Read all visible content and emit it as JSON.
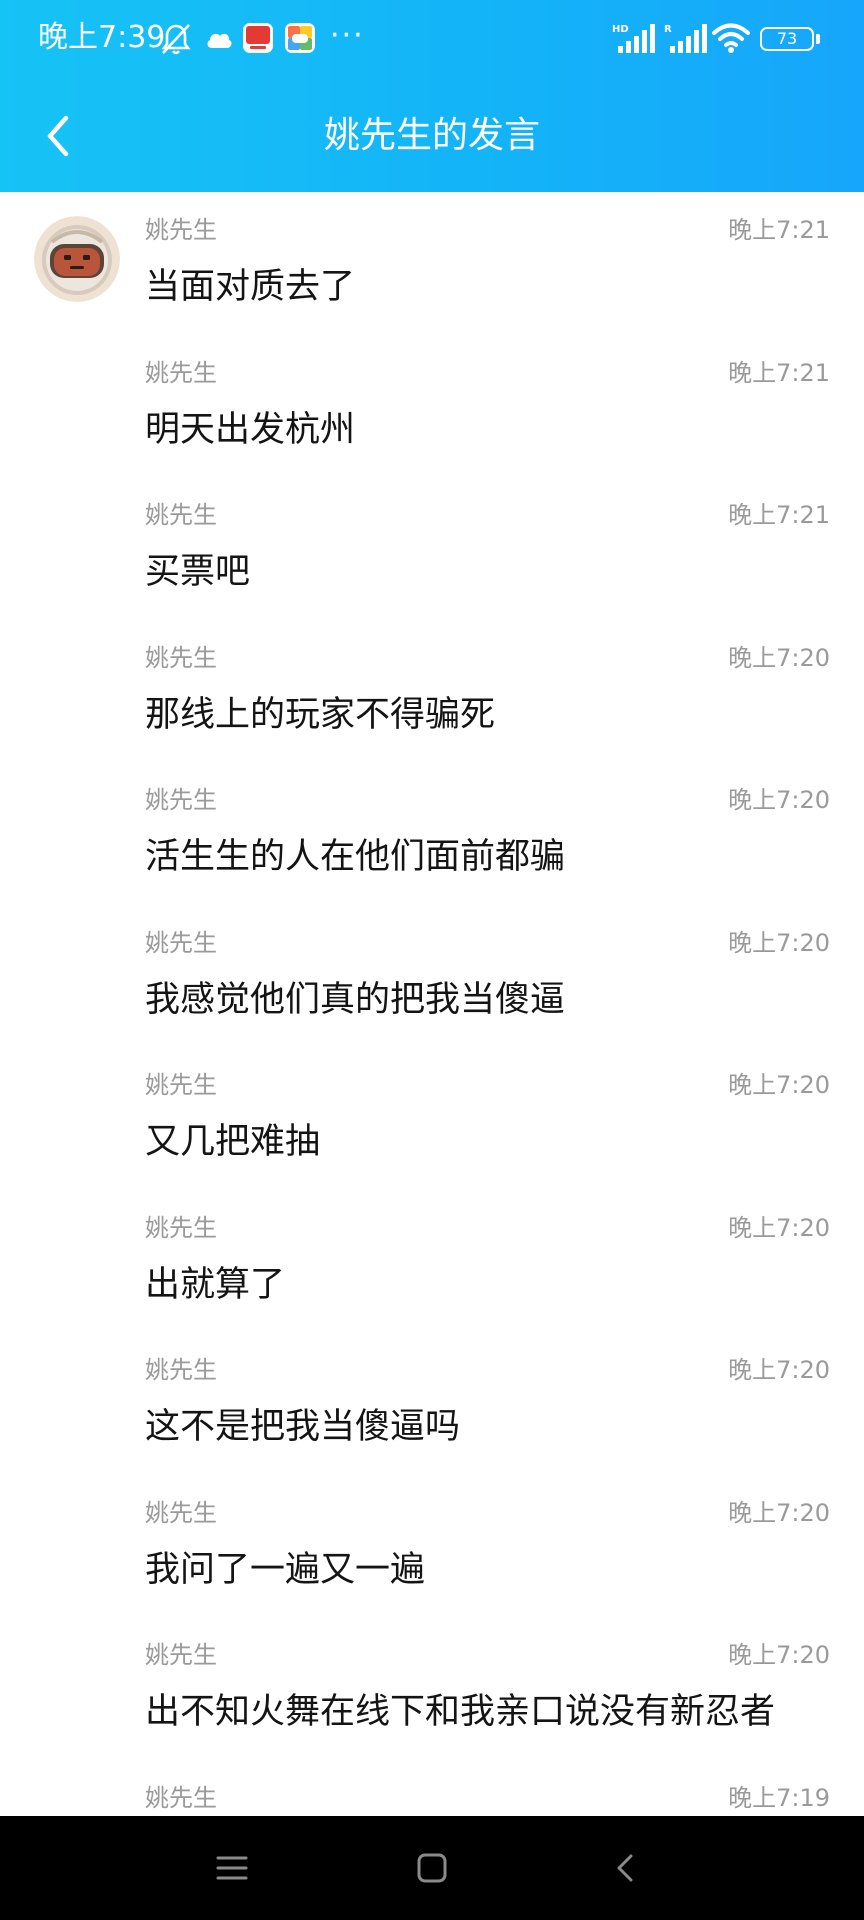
{
  "status_bar": {
    "time": "晚上7:39",
    "more": "···",
    "battery": "73",
    "network_hd": "HD",
    "network_r": "R"
  },
  "header": {
    "title": "姚先生的发言",
    "back_icon": "chevron-left-icon"
  },
  "colors": {
    "header_start": "#16c3f5",
    "header_end": "#16a6fb",
    "meta_text": "#9a9a9a",
    "message_text": "#141414",
    "nav_bar": "#000000"
  },
  "messages": [
    {
      "sender": "姚先生",
      "time": "晚上7:21",
      "text": "当面对质去了"
    },
    {
      "sender": "姚先生",
      "time": "晚上7:21",
      "text": "明天出发杭州"
    },
    {
      "sender": "姚先生",
      "time": "晚上7:21",
      "text": "买票吧"
    },
    {
      "sender": "姚先生",
      "time": "晚上7:20",
      "text": "那线上的玩家不得骗死"
    },
    {
      "sender": "姚先生",
      "time": "晚上7:20",
      "text": "活生生的人在他们面前都骗"
    },
    {
      "sender": "姚先生",
      "time": "晚上7:20",
      "text": "我感觉他们真的把我当傻逼"
    },
    {
      "sender": "姚先生",
      "time": "晚上7:20",
      "text": "又几把难抽"
    },
    {
      "sender": "姚先生",
      "time": "晚上7:20",
      "text": "出就算了"
    },
    {
      "sender": "姚先生",
      "time": "晚上7:20",
      "text": "这不是把我当傻逼吗"
    },
    {
      "sender": "姚先生",
      "time": "晚上7:20",
      "text": "我问了一遍又一遍"
    },
    {
      "sender": "姚先生",
      "time": "晚上7:20",
      "text": "出不知火舞在线下和我亲口说没有新忍者"
    },
    {
      "sender": "姚先生",
      "time": "晚上7:19",
      "text": ""
    }
  ],
  "nav_bar": {
    "menu_icon": "menu-icon",
    "home_icon": "home-icon",
    "back_icon": "back-triangle-icon"
  }
}
